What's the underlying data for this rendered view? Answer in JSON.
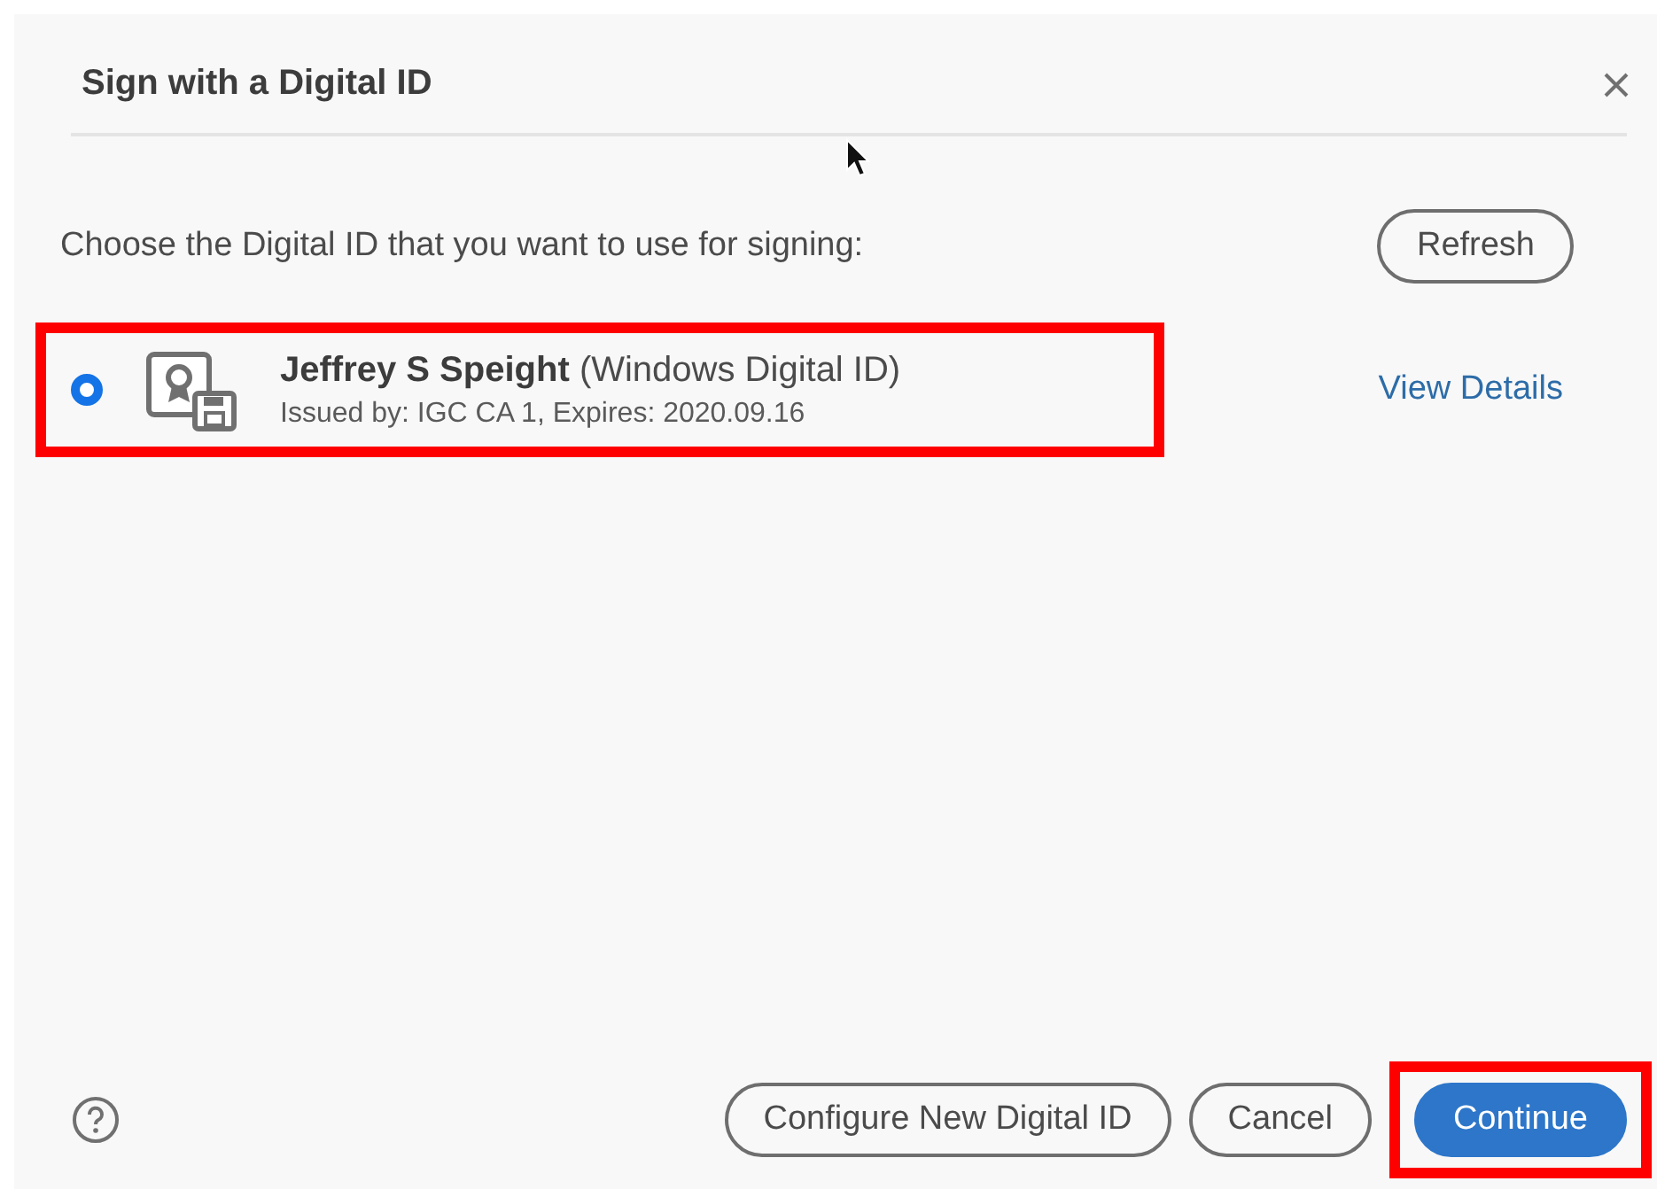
{
  "dialog": {
    "title": "Sign with a Digital ID"
  },
  "instruction": "Choose the Digital ID that you want to use for signing:",
  "refresh_button": "Refresh",
  "digital_ids": [
    {
      "name": "Jeffrey S Speight",
      "type": "(Windows Digital ID)",
      "details": "Issued by: IGC CA 1, Expires: 2020.09.16",
      "selected": true,
      "highlighted": true,
      "link": "View Details"
    }
  ],
  "footer_buttons": [
    {
      "label": "Configure New Digital ID",
      "kind": "secondary",
      "highlighted": false
    },
    {
      "label": "Cancel",
      "kind": "secondary",
      "highlighted": false
    },
    {
      "label": "Continue",
      "kind": "primary",
      "highlighted": true
    }
  ]
}
